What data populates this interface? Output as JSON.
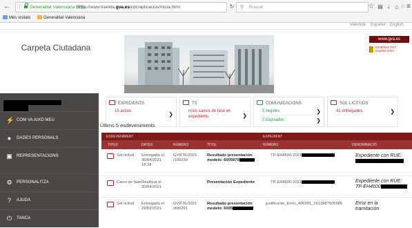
{
  "browser": {
    "url_site": "Generalitat Valenciana (ES)",
    "url_prefix": "https://www.tramita.",
    "url_domain": "gva.es",
    "url_suffix": "/cdc/aplicacios/inicia.html",
    "search_placeholder": "Buscar",
    "bookmarks": [
      "Més visitats",
      "Generalitat Valenciana"
    ]
  },
  "languages": [
    "Valencià",
    "Español",
    "English"
  ],
  "header": {
    "title": "Carpeta Ciutadana",
    "gva_url": "www.gva.es",
    "gva_logo_lines": [
      "GENERALITAT",
      "VALENCIANA"
    ]
  },
  "sidebar": {
    "items": [
      {
        "icon": "lightning-icon",
        "label": "COM VA AIXÒ MEU"
      },
      {
        "icon": "person-icon",
        "label": "DADES PERSONALS"
      },
      {
        "icon": "id-card-icon",
        "label": "REPRESENTACIONS"
      },
      {
        "icon": "gear-icon",
        "label": "PERSONALITZA"
      },
      {
        "icon": "question-icon",
        "label": "AJUDA"
      },
      {
        "icon": "power-icon",
        "label": "TANCA"
      }
    ]
  },
  "cards": [
    {
      "title": "EXPEDIENTS",
      "line1": "15 actius",
      "line2": ""
    },
    {
      "title": "TS",
      "line1": "nous canvis de fase en",
      "line2": "expedients"
    },
    {
      "title": "COMUNICACIONS",
      "line1": "5 llegides",
      "line2": "2 Expirades"
    },
    {
      "title": "SOL·LICITUDS",
      "line1": "41 entregades",
      "line2": ""
    }
  ],
  "recent": {
    "title": "Últims 5 esdeveniments",
    "group_headers": [
      "ESDEVENIMENT",
      "EXPEDIENT"
    ],
    "columns": [
      "TIPUS",
      "DATES",
      "NÚMERO",
      "TÍTOL",
      "NÚMERO",
      "DENOMINACIÓ"
    ],
    "rows": [
      {
        "tipus": "Sol·licitud",
        "dates": [
          "Entregada el",
          "30/04/2021",
          "18:28"
        ],
        "numero": [
          "GVRTE/2021",
          "/109239"
        ],
        "titol": [
          "Resultado presentación",
          "modelo: 6005970"
        ],
        "exp_numero": "TP-EH4600-2021",
        "denominacio": [
          "Expediente con RUE:",
          ""
        ]
      },
      {
        "tipus": "Canvi de fase",
        "dates": [
          "Realitzat el",
          "30/04/2021"
        ],
        "numero": [
          "",
          ""
        ],
        "titol": [
          "Presentación Expediente",
          ""
        ],
        "exp_numero": "TP-EH4600-2021",
        "denominacio": [
          "Expediente con RUE:",
          "TP-EH4600"
        ]
      },
      {
        "tipus": "Sol·licitud",
        "dates": [
          "Entregada el",
          "22/02/2021"
        ],
        "numero": [
          "GVRTE/2021",
          "/406391"
        ],
        "titol": [
          "Resultado presentación",
          "modelo: 6005"
        ],
        "exp_numero": "justificante_Error_406391_1613987505985",
        "denominacio": [
          "Error en la",
          "tramitación"
        ]
      }
    ]
  }
}
